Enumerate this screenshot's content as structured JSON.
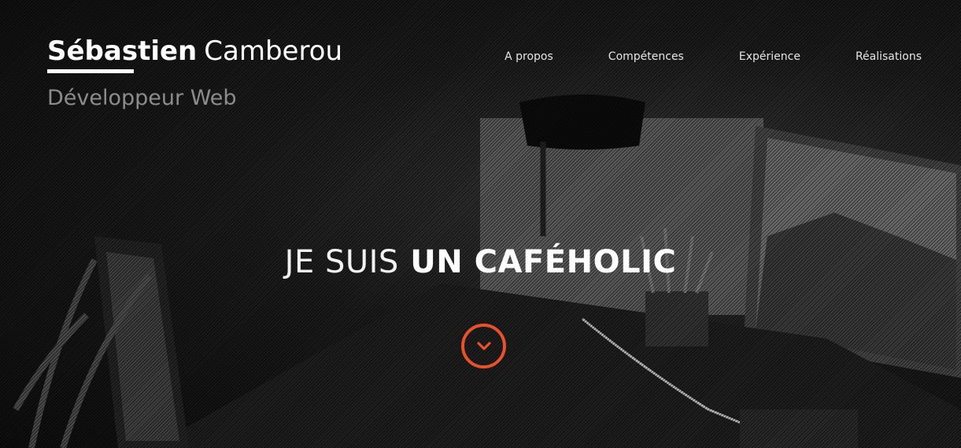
{
  "brand": {
    "first_name": "Sébastien",
    "last_name": "Camberou",
    "subtitle": "Développeur Web"
  },
  "nav": {
    "items": [
      {
        "label": "A propos"
      },
      {
        "label": "Compétences"
      },
      {
        "label": "Expérience"
      },
      {
        "label": "Réalisations"
      }
    ]
  },
  "hero": {
    "headline_light": "JE SUIS",
    "headline_bold": "UN CAFÉHOLIC",
    "scroll_icon": "chevron-down-icon"
  },
  "colors": {
    "accent": "#e8512a",
    "text": "#ffffff",
    "subtitle": "#8c8c8c",
    "background": "#1c1c1c"
  }
}
